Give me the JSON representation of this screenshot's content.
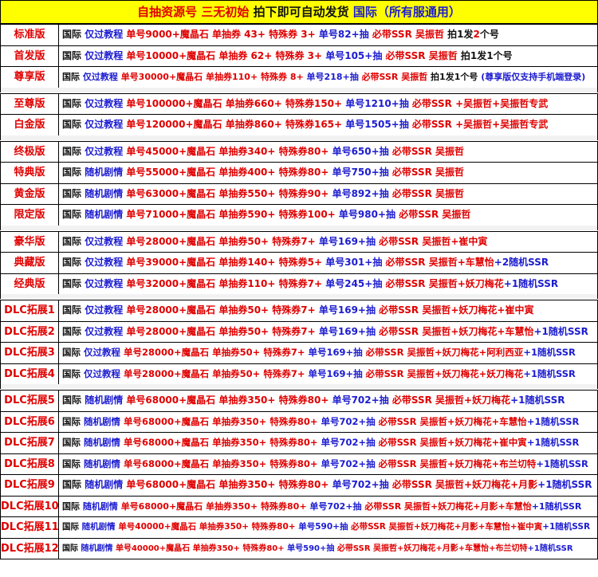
{
  "colors": {
    "red": "#e00000",
    "blue": "#1c1cd0",
    "black": "#111111",
    "header_bg": "#ffff00",
    "sep_bg": "#f2f2f2"
  },
  "header": [
    {
      "text": "自抽资源号 三无初始 ",
      "color": "red"
    },
    {
      "text": "拍下即可自动发货 ",
      "color": "black"
    },
    {
      "text": "国际（所有服通用）",
      "color": "blue"
    }
  ],
  "rows": [
    {
      "label": "标准版",
      "segments": [
        {
          "text": "国际 ",
          "color": "black"
        },
        {
          "text": "仅过教程 ",
          "color": "blue"
        },
        {
          "text": "单号9000+魔晶石 单抽券 43+ 特殊券 3+ ",
          "color": "red"
        },
        {
          "text": "单号82+抽 ",
          "color": "blue"
        },
        {
          "text": "必带SSR 吴振哲 ",
          "color": "red"
        },
        {
          "text": "拍1发",
          "color": "black"
        },
        {
          "text": "2",
          "color": "red"
        },
        {
          "text": "个号",
          "color": "black"
        }
      ]
    },
    {
      "label": "首发版",
      "segments": [
        {
          "text": "国际 ",
          "color": "black"
        },
        {
          "text": "仅过教程 ",
          "color": "blue"
        },
        {
          "text": "单号10000+魔晶石 单抽券 62+ 特殊券 3+ ",
          "color": "red"
        },
        {
          "text": "单号105+抽 ",
          "color": "blue"
        },
        {
          "text": "必带SSR 吴振哲 ",
          "color": "red"
        },
        {
          "text": "拍1发1个号",
          "color": "black"
        }
      ]
    },
    {
      "label": "尊享版",
      "segments": [
        {
          "text": "国际 ",
          "color": "black"
        },
        {
          "text": "仅过教程 ",
          "color": "blue"
        },
        {
          "text": "单号30000+魔晶石 单抽券110+ 特殊券 8+ ",
          "color": "red"
        },
        {
          "text": "单号218+抽 ",
          "color": "blue"
        },
        {
          "text": "必带SSR 吴振哲 ",
          "color": "red"
        },
        {
          "text": "拍1发1个号 ",
          "color": "black"
        },
        {
          "text": "(尊享版仅支持手机端登录)",
          "color": "blue"
        }
      ]
    },
    {
      "label": "至尊版",
      "segments": [
        {
          "text": "国际 ",
          "color": "black"
        },
        {
          "text": "仅过教程 ",
          "color": "blue"
        },
        {
          "text": "单号100000+魔晶石 单抽券660+ 特殊券150+ ",
          "color": "red"
        },
        {
          "text": "单号1210+抽 ",
          "color": "blue"
        },
        {
          "text": "必带SSR +吴振哲+吴振哲专武",
          "color": "red"
        }
      ]
    },
    {
      "label": "白金版",
      "segments": [
        {
          "text": "国际 ",
          "color": "black"
        },
        {
          "text": "仅过教程 ",
          "color": "blue"
        },
        {
          "text": "单号120000+魔晶石 单抽券860+ 特殊券165+ ",
          "color": "red"
        },
        {
          "text": "单号1505+抽 ",
          "color": "blue"
        },
        {
          "text": "必带SSR +吴振哲+吴振哲专武",
          "color": "red"
        }
      ]
    },
    {
      "label": "终极版",
      "segments": [
        {
          "text": "国际 ",
          "color": "black"
        },
        {
          "text": "仅过教程 ",
          "color": "blue"
        },
        {
          "text": "单号45000+魔晶石 单抽券340+ 特殊券80+  ",
          "color": "red"
        },
        {
          "text": "单号650+抽 ",
          "color": "blue"
        },
        {
          "text": "必带SSR 吴振哲",
          "color": "red"
        }
      ]
    },
    {
      "label": "特典版",
      "segments": [
        {
          "text": "国际 ",
          "color": "black"
        },
        {
          "text": "随机剧情 ",
          "color": "blue"
        },
        {
          "text": "单号55000+魔晶石 单抽券400+ 特殊券80+  ",
          "color": "red"
        },
        {
          "text": "单号750+抽 ",
          "color": "blue"
        },
        {
          "text": "必带SSR 吴振哲",
          "color": "red"
        }
      ]
    },
    {
      "label": "黄金版",
      "segments": [
        {
          "text": "国际 ",
          "color": "black"
        },
        {
          "text": "随机剧情 ",
          "color": "blue"
        },
        {
          "text": "单号63000+魔晶石 单抽券550+ 特殊券90+  ",
          "color": "red"
        },
        {
          "text": "单号892+抽 ",
          "color": "blue"
        },
        {
          "text": "必带SSR 吴振哲",
          "color": "red"
        }
      ]
    },
    {
      "label": "限定版",
      "segments": [
        {
          "text": "国际 ",
          "color": "black"
        },
        {
          "text": "随机剧情 ",
          "color": "blue"
        },
        {
          "text": "单号71000+魔晶石 单抽券590+ 特殊券100+ ",
          "color": "red"
        },
        {
          "text": "单号980+抽 ",
          "color": "blue"
        },
        {
          "text": "必带SSR 吴振哲",
          "color": "red"
        }
      ]
    },
    {
      "label": "豪华版",
      "segments": [
        {
          "text": "国际 ",
          "color": "black"
        },
        {
          "text": "仅过教程 ",
          "color": "blue"
        },
        {
          "text": "单号28000+魔晶石 单抽券50+  特殊券7+  ",
          "color": "red"
        },
        {
          "text": "单号169+抽 ",
          "color": "blue"
        },
        {
          "text": "必带SSR 吴振哲+崔中寅",
          "color": "red"
        }
      ]
    },
    {
      "label": "典藏版",
      "segments": [
        {
          "text": "国际 ",
          "color": "black"
        },
        {
          "text": "仅过教程 ",
          "color": "blue"
        },
        {
          "text": "单号39000+魔晶石 单抽券140+ 特殊券5+  ",
          "color": "red"
        },
        {
          "text": "单号301+抽 ",
          "color": "blue"
        },
        {
          "text": "必带SSR 吴振哲+车慧怡",
          "color": "red"
        },
        {
          "text": "+2随机SSR",
          "color": "blue"
        }
      ]
    },
    {
      "label": "经典版",
      "segments": [
        {
          "text": "国际 ",
          "color": "black"
        },
        {
          "text": "仅过教程 ",
          "color": "blue"
        },
        {
          "text": "单号32000+魔晶石 单抽券110+ 特殊券7+  ",
          "color": "red"
        },
        {
          "text": "单号245+抽 ",
          "color": "blue"
        },
        {
          "text": "必带SSR 吴振哲+妖刀梅花",
          "color": "red"
        },
        {
          "text": "+1随机SSR",
          "color": "blue"
        }
      ]
    },
    {
      "label": "DLC拓展1",
      "segments": [
        {
          "text": "国际 ",
          "color": "black"
        },
        {
          "text": "仅过教程 ",
          "color": "blue"
        },
        {
          "text": "单号28000+魔晶石 单抽券50+ 特殊券7+  ",
          "color": "red"
        },
        {
          "text": "单号169+抽 ",
          "color": "blue"
        },
        {
          "text": "必带SSR 吴振哲+妖刀梅花+崔中寅",
          "color": "red"
        }
      ]
    },
    {
      "label": "DLC拓展2",
      "segments": [
        {
          "text": "国际 ",
          "color": "black"
        },
        {
          "text": "仅过教程 ",
          "color": "blue"
        },
        {
          "text": "单号28000+魔晶石 单抽券50+ 特殊券7+  ",
          "color": "red"
        },
        {
          "text": "单号169+抽 ",
          "color": "blue"
        },
        {
          "text": "必带SSR 吴振哲+妖刀梅花+车慧怡",
          "color": "red"
        },
        {
          "text": "+1随机SSR",
          "color": "blue"
        }
      ]
    },
    {
      "label": "DLC拓展3",
      "segments": [
        {
          "text": "国际 ",
          "color": "black"
        },
        {
          "text": "仅过教程 ",
          "color": "blue"
        },
        {
          "text": "单号28000+魔晶石 单抽券50+ 特殊券7+  ",
          "color": "red"
        },
        {
          "text": "单号169+抽 ",
          "color": "blue"
        },
        {
          "text": "必带SSR 吴振哲+妖刀梅花+阿利西亚",
          "color": "red"
        },
        {
          "text": "+1随机SSR",
          "color": "blue"
        }
      ]
    },
    {
      "label": "DLC拓展4",
      "segments": [
        {
          "text": "国际 ",
          "color": "black"
        },
        {
          "text": "仅过教程 ",
          "color": "blue"
        },
        {
          "text": "单号28000+魔晶石 单抽券50+ 特殊券7+  ",
          "color": "red"
        },
        {
          "text": "单号169+抽 ",
          "color": "blue"
        },
        {
          "text": "必带SSR 吴振哲+妖刀梅花+妖刀梅花",
          "color": "red"
        },
        {
          "text": "+1随机SSR",
          "color": "blue"
        }
      ]
    },
    {
      "label": "DLC拓展5",
      "segments": [
        {
          "text": "国际 ",
          "color": "black"
        },
        {
          "text": "随机剧情 ",
          "color": "blue"
        },
        {
          "text": "单号68000+魔晶石 单抽券350+ 特殊券80+ ",
          "color": "red"
        },
        {
          "text": "单号702+抽 ",
          "color": "blue"
        },
        {
          "text": "必带SSR 吴振哲+妖刀梅花",
          "color": "red"
        },
        {
          "text": "+1随机SSR",
          "color": "blue"
        }
      ]
    },
    {
      "label": "DLC拓展6",
      "segments": [
        {
          "text": "国际 ",
          "color": "black"
        },
        {
          "text": "随机剧情 ",
          "color": "blue"
        },
        {
          "text": "单号68000+魔晶石 单抽券350+ 特殊券80+ ",
          "color": "red"
        },
        {
          "text": "单号702+抽 ",
          "color": "blue"
        },
        {
          "text": "必带SSR 吴振哲+妖刀梅花+车慧怡",
          "color": "red"
        },
        {
          "text": "+1随机SSR",
          "color": "blue"
        }
      ]
    },
    {
      "label": "DLC拓展7",
      "segments": [
        {
          "text": "国际 ",
          "color": "black"
        },
        {
          "text": "随机剧情 ",
          "color": "blue"
        },
        {
          "text": "单号68000+魔晶石 单抽券350+ 特殊券80+ ",
          "color": "red"
        },
        {
          "text": "单号702+抽 ",
          "color": "blue"
        },
        {
          "text": "必带SSR 吴振哲+妖刀梅花+崔中寅",
          "color": "red"
        },
        {
          "text": "+1随机SSR",
          "color": "blue"
        }
      ]
    },
    {
      "label": "DLC拓展8",
      "segments": [
        {
          "text": "国际 ",
          "color": "black"
        },
        {
          "text": "随机剧情 ",
          "color": "blue"
        },
        {
          "text": "单号68000+魔晶石 单抽券350+ 特殊券80+ ",
          "color": "red"
        },
        {
          "text": "单号702+抽 ",
          "color": "blue"
        },
        {
          "text": "必带SSR 吴振哲+妖刀梅花+布兰切特",
          "color": "red"
        },
        {
          "text": "+1随机SSR",
          "color": "blue"
        }
      ]
    },
    {
      "label": "DLC拓展9",
      "segments": [
        {
          "text": "国际 ",
          "color": "black"
        },
        {
          "text": "随机剧情 ",
          "color": "blue"
        },
        {
          "text": "单号68000+魔晶石 单抽券350+ 特殊券80+ ",
          "color": "red"
        },
        {
          "text": "单号702+抽 ",
          "color": "blue"
        },
        {
          "text": "必带SSR 吴振哲+妖刀梅花+月影",
          "color": "red"
        },
        {
          "text": "+1随机SSR",
          "color": "blue"
        }
      ]
    },
    {
      "label": "DLC拓展10",
      "segments": [
        {
          "text": "国际 ",
          "color": "black"
        },
        {
          "text": "随机剧情 ",
          "color": "blue"
        },
        {
          "text": "单号68000+魔晶石 单抽券350+ 特殊券80+ ",
          "color": "red"
        },
        {
          "text": "单号702+抽 ",
          "color": "blue"
        },
        {
          "text": "必带SSR 吴振哲+妖刀梅花+月影+车慧怡",
          "color": "red"
        },
        {
          "text": "+1随机SSR",
          "color": "blue"
        }
      ]
    },
    {
      "label": "DLC拓展11",
      "segments": [
        {
          "text": "国际 ",
          "color": "black"
        },
        {
          "text": "随机剧情 ",
          "color": "blue"
        },
        {
          "text": "单号40000+魔晶石 单抽券350+ 特殊券80+ ",
          "color": "red"
        },
        {
          "text": "单号590+抽 ",
          "color": "blue"
        },
        {
          "text": "必带SSR 吴振哲+妖刀梅花+月影+车慧怡+崔中寅",
          "color": "red"
        },
        {
          "text": "+1随机SSR",
          "color": "blue"
        }
      ]
    },
    {
      "label": "DLC拓展12",
      "segments": [
        {
          "text": "国际 ",
          "color": "black"
        },
        {
          "text": "随机剧情 ",
          "color": "blue"
        },
        {
          "text": "单号40000+魔晶石 单抽券350+ 特殊券80+ ",
          "color": "red"
        },
        {
          "text": "单号590+抽 ",
          "color": "blue"
        },
        {
          "text": "必带SSR 吴振哲+妖刀梅花+月影+车慧怡+布兰切特",
          "color": "red"
        },
        {
          "text": "+1随机SSR",
          "color": "blue"
        }
      ]
    }
  ]
}
